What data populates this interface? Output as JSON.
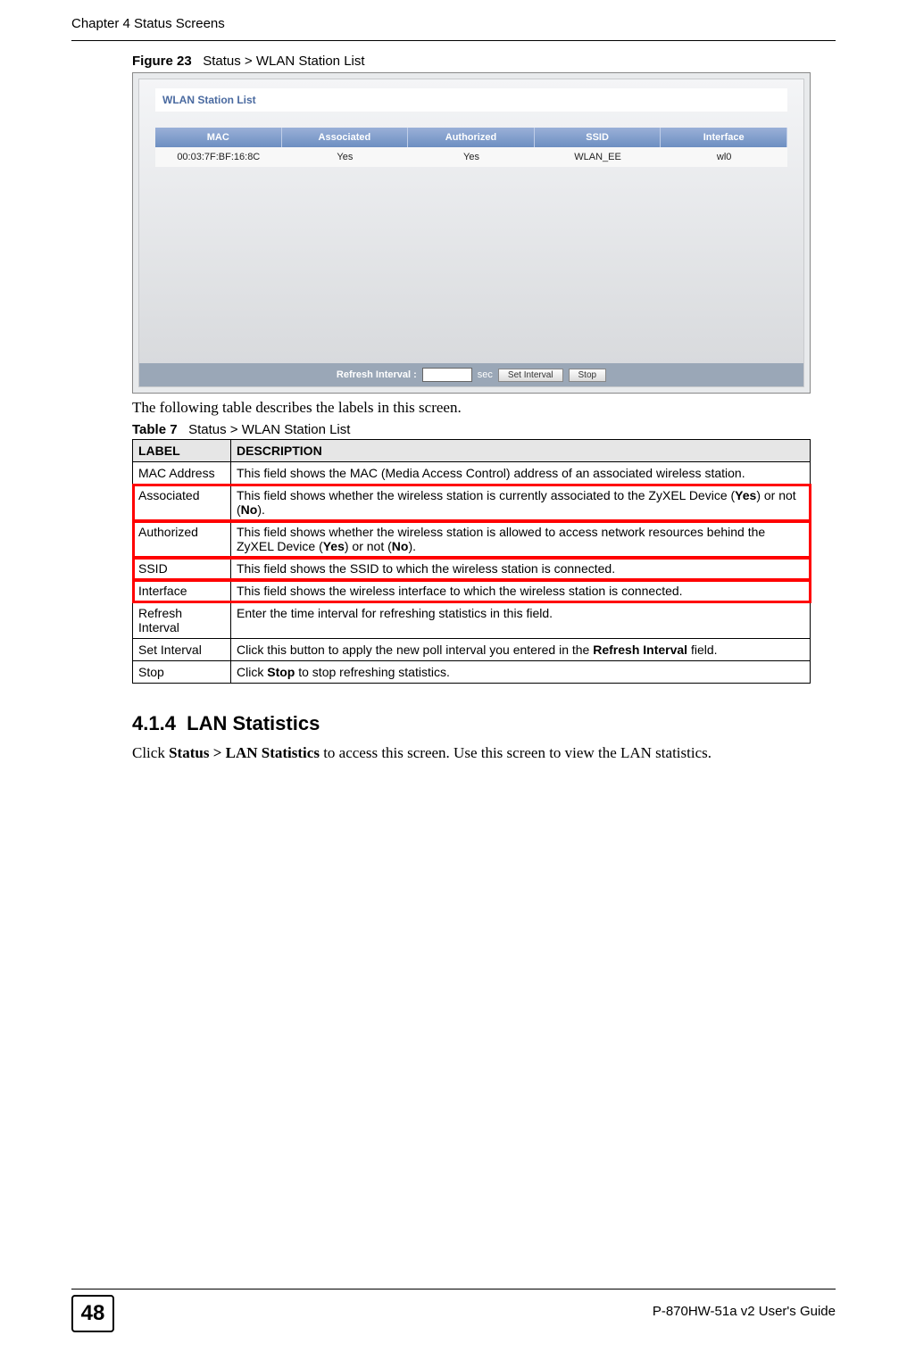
{
  "header": {
    "chapter": "Chapter 4 Status Screens"
  },
  "figure": {
    "label": "Figure 23",
    "title": "Status > WLAN Station List"
  },
  "screenshot": {
    "panel_title": "WLAN Station List",
    "columns": [
      "MAC",
      "Associated",
      "Authorized",
      "SSID",
      "Interface"
    ],
    "row": {
      "mac": "00:03:7F:BF:16:8C",
      "associated": "Yes",
      "authorized": "Yes",
      "ssid": "WLAN_EE",
      "interface": "wl0"
    },
    "footer": {
      "label": "Refresh Interval :",
      "unit": "sec",
      "set_btn": "Set Interval",
      "stop_btn": "Stop"
    }
  },
  "lead_text": "The following table describes the labels in this screen.",
  "table_caption": {
    "label": "Table 7",
    "title": "Status > WLAN Station List"
  },
  "table": {
    "head": {
      "label": "LABEL",
      "desc": "DESCRIPTION"
    },
    "rows": [
      {
        "label": "MAC Address",
        "desc": "This field shows the MAC (Media Access Control) address of an associated wireless station.",
        "hl": false
      },
      {
        "label": "Associated",
        "desc_pre": "This field shows whether the wireless station is currently associated to the ZyXEL Device (",
        "b1": "Yes",
        "mid": ") or not (",
        "b2": "No",
        "desc_post": ").",
        "hl": true
      },
      {
        "label": "Authorized",
        "desc_pre": "This field shows whether the wireless station is allowed to access network resources behind the ZyXEL Device (",
        "b1": "Yes",
        "mid": ") or not (",
        "b2": "No",
        "desc_post": ").",
        "hl": true
      },
      {
        "label": "SSID",
        "desc": "This field shows the SSID to which the wireless station is connected.",
        "hl": true
      },
      {
        "label": "Interface",
        "desc": "This field shows the wireless interface to which the wireless station is connected.",
        "hl": true
      },
      {
        "label": "Refresh Interval",
        "desc": "Enter the time interval for refreshing statistics in this field.",
        "hl": false
      },
      {
        "label": "Set Interval",
        "desc_pre": "Click this button to apply the new poll interval you entered in the ",
        "b1": "Refresh Interval",
        "desc_post": " field.",
        "hl": false
      },
      {
        "label": "Stop",
        "desc_pre": "Click ",
        "b1": "Stop",
        "desc_post": " to stop refreshing statistics.",
        "hl": false
      }
    ]
  },
  "section": {
    "number": "4.1.4",
    "title": "LAN Statistics",
    "body_pre": "Click ",
    "body_bold": "Status > LAN Statistics",
    "body_post": " to access this screen. Use this screen to view the LAN statistics."
  },
  "footer": {
    "page": "48",
    "guide": "P-870HW-51a v2 User's Guide"
  }
}
